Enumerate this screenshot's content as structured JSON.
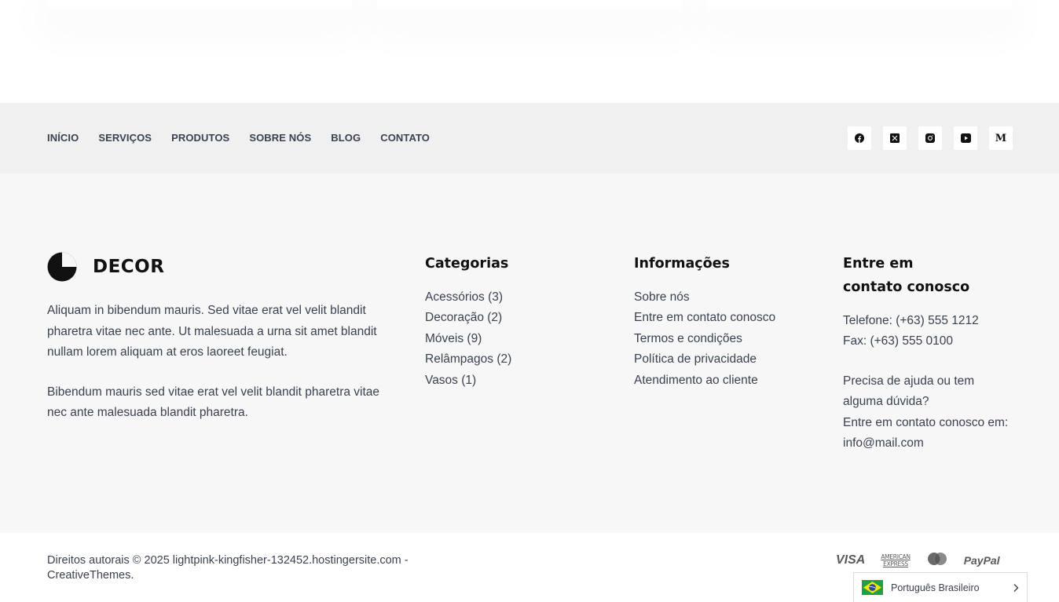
{
  "nav": {
    "items": [
      "INÍCIO",
      "SERVIÇOS",
      "PRODUTOS",
      "SOBRE NÓS",
      "BLOG",
      "CONTATO"
    ]
  },
  "socials": [
    "facebook-icon",
    "x-twitter-icon",
    "instagram-icon",
    "youtube-icon",
    "medium-icon"
  ],
  "medium_letter": "M",
  "brand": {
    "name": "DECOR"
  },
  "about": {
    "p1": "Aliquam in bibendum mauris. Sed vitae erat vel velit blandit pharetra vitae nec ante. Ut malesuada a urna sit amet blandit nullam lorem aliquam at eros laoreet feugiat.",
    "p2": "Bibendum mauris sed vitae erat vel velit blandit pharetra vitae nec ante malesuada blandit pharetra."
  },
  "categories": {
    "title": "Categorias",
    "items": [
      "Acessórios (3)",
      "Decoração (2)",
      "Móveis (9)",
      "Relâmpagos (2)",
      "Vasos (1)"
    ]
  },
  "info": {
    "title": "Informações",
    "items": [
      "Sobre nós",
      "Entre em contato conosco",
      "Termos e condições",
      "Política de privacidade",
      "Atendimento ao cliente"
    ]
  },
  "contact": {
    "title": "Entre em contato conosco",
    "phone": "Telefone: (+63) 555 1212",
    "fax": "Fax: (+63) 555 0100",
    "help": "Precisa de ajuda ou tem alguma dúvida?",
    "reach": "Entre em contato conosco em:",
    "email": "info@mail.com"
  },
  "copyright": "Direitos autorais © 2025 lightpink-kingfisher-132452.hostingersite.com - CreativeThemes.",
  "payments": {
    "visa": "VISA",
    "amex_top": "AMERICAN",
    "amex_bottom": "EXPRESS",
    "paypal": "PayPal"
  },
  "language": {
    "label": "Português Brasileiro"
  },
  "colors": {
    "nav_bg": "#f0f0f0",
    "footer_bg": "#f7f7f7",
    "text": "#3a4250",
    "heading": "#111111"
  }
}
